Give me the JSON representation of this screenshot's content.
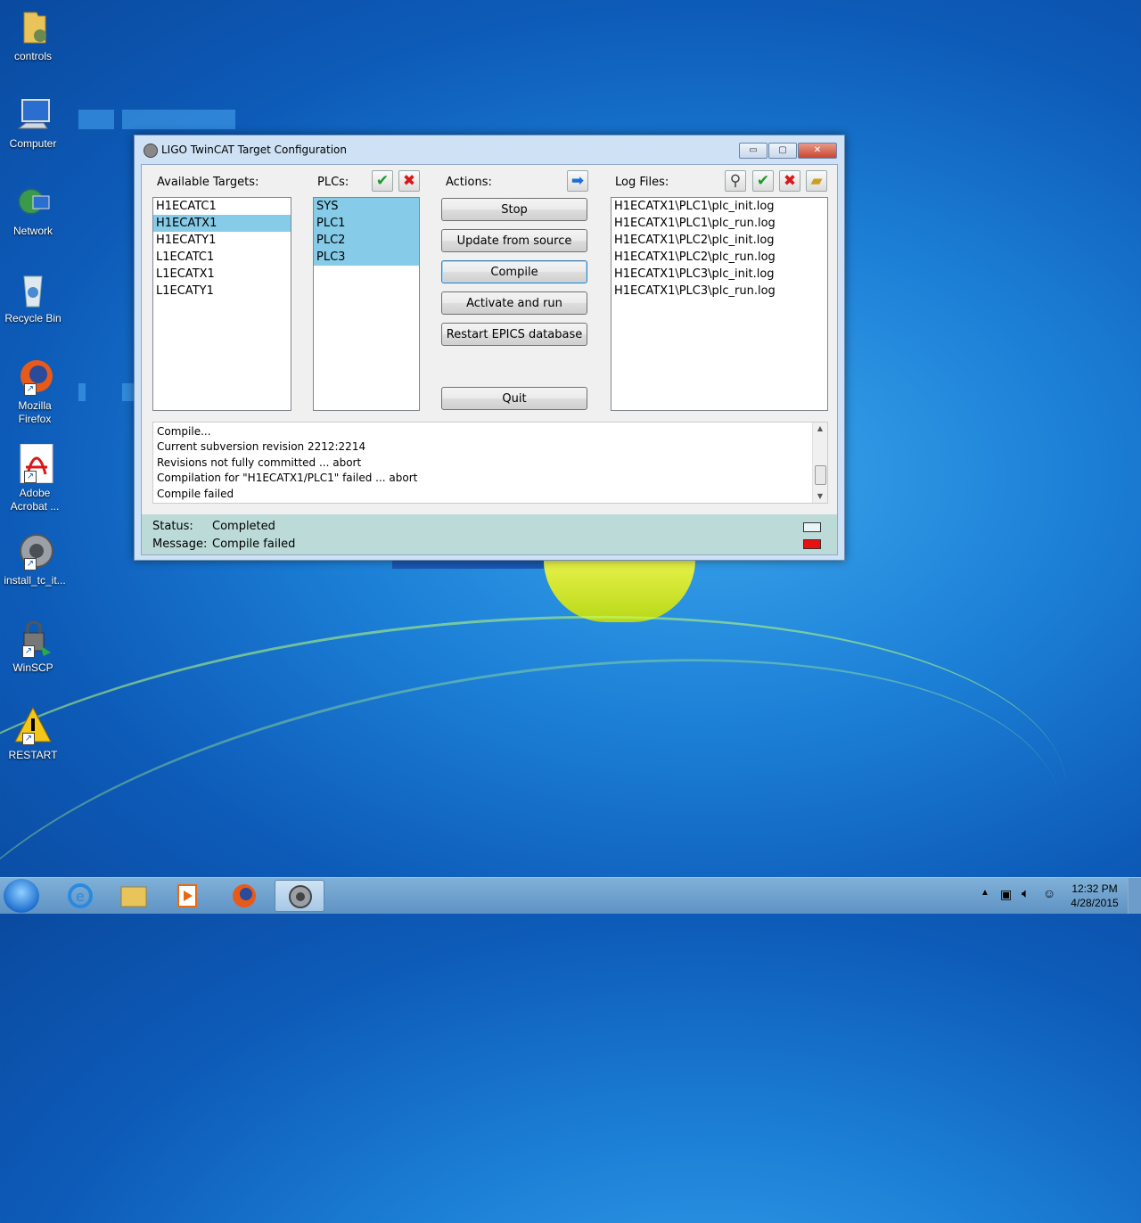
{
  "desktop": {
    "icons": [
      {
        "label": "controls",
        "icon": "folder-icon"
      },
      {
        "label": "Computer",
        "icon": "computer-icon"
      },
      {
        "label": "Network",
        "icon": "network-icon"
      },
      {
        "label": "Recycle Bin",
        "icon": "recycle-bin-icon"
      },
      {
        "label": "Mozilla Firefox",
        "icon": "firefox-icon"
      },
      {
        "label": "Adobe Acrobat ...",
        "icon": "acrobat-icon"
      },
      {
        "label": "install_tc_it...",
        "icon": "gear-icon"
      },
      {
        "label": "WinSCP",
        "icon": "winscp-icon"
      },
      {
        "label": "RESTART",
        "icon": "warning-icon"
      }
    ]
  },
  "window": {
    "title": "LIGO TwinCAT Target Configuration",
    "controls": {
      "minimize": "▭",
      "maximize": "▢",
      "close": "✕"
    }
  },
  "targets": {
    "label": "Available Targets:",
    "items": [
      "H1ECATC1",
      "H1ECATX1",
      "H1ECATY1",
      "L1ECATC1",
      "L1ECATX1",
      "L1ECATY1"
    ],
    "selected": "H1ECATX1"
  },
  "plcs": {
    "label": "PLCs:",
    "items": [
      "SYS",
      "PLC1",
      "PLC2",
      "PLC3"
    ],
    "selected_all": true
  },
  "actions": {
    "label": "Actions:",
    "buttons": {
      "stop": "Stop",
      "update": "Update from source",
      "compile": "Compile",
      "activate": "Activate and run",
      "restart_epics": "Restart EPICS database",
      "quit": "Quit"
    }
  },
  "logs": {
    "label": "Log Files:",
    "items": [
      "H1ECATX1\\PLC1\\plc_init.log",
      "H1ECATX1\\PLC1\\plc_run.log",
      "H1ECATX1\\PLC2\\plc_init.log",
      "H1ECATX1\\PLC2\\plc_run.log",
      "H1ECATX1\\PLC3\\plc_init.log",
      "H1ECATX1\\PLC3\\plc_run.log"
    ]
  },
  "console": {
    "lines": [
      "Compile...",
      "Current subversion revision 2212:2214",
      "Revisions not fully committed ... abort",
      "Compilation for \"H1ECATX1/PLC1\" failed ... abort",
      "Compile failed"
    ]
  },
  "status": {
    "status_label": "Status:",
    "status_value": "Completed",
    "message_label": "Message:",
    "message_value": "Compile failed",
    "status_color": "#e8f4f8",
    "message_color": "#e81010"
  },
  "taskbar": {
    "clock_time": "12:32 PM",
    "clock_date": "4/28/2015",
    "accent": "#5f93c4"
  }
}
